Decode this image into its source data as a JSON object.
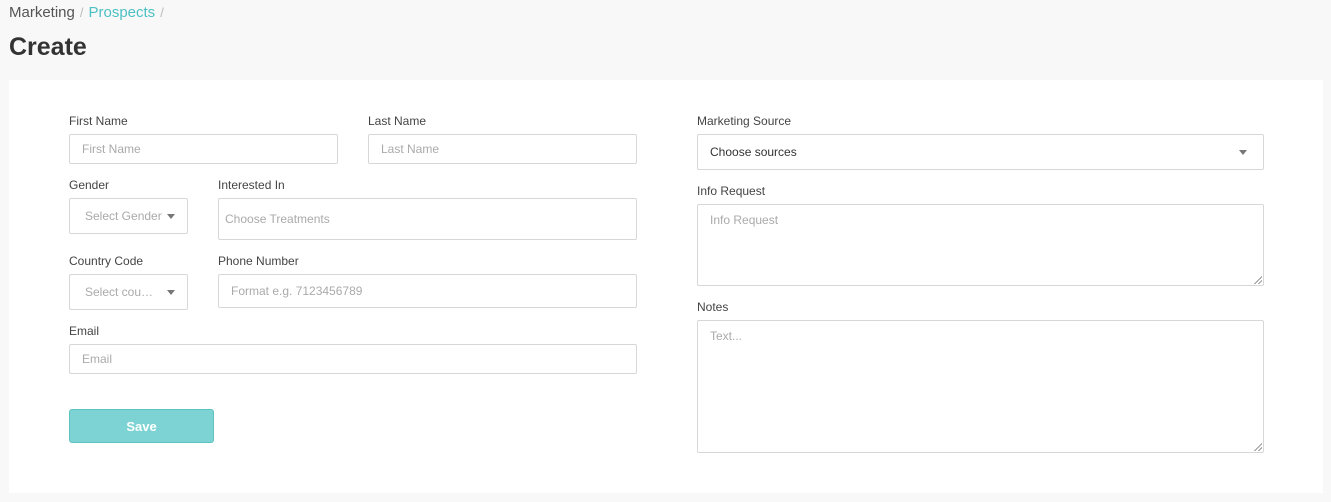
{
  "breadcrumb": {
    "root": "Marketing",
    "current": "Prospects",
    "separator": "/"
  },
  "page_title": "Create",
  "form": {
    "first_name": {
      "label": "First Name",
      "placeholder": "First Name"
    },
    "last_name": {
      "label": "Last Name",
      "placeholder": "Last Name"
    },
    "gender": {
      "label": "Gender",
      "placeholder": "Select Gender"
    },
    "interested_in": {
      "label": "Interested In",
      "placeholder": "Choose Treatments"
    },
    "country_code": {
      "label": "Country Code",
      "placeholder": "Select count..."
    },
    "phone_number": {
      "label": "Phone Number",
      "placeholder": "Format e.g. 7123456789"
    },
    "email": {
      "label": "Email",
      "placeholder": "Email"
    },
    "marketing_source": {
      "label": "Marketing Source",
      "value": "Choose sources"
    },
    "info_request": {
      "label": "Info Request",
      "placeholder": "Info Request"
    },
    "notes": {
      "label": "Notes",
      "placeholder": "Text..."
    },
    "save_label": "Save"
  },
  "colors": {
    "accent": "#4cc1c4",
    "button": "#7dd3d3"
  }
}
